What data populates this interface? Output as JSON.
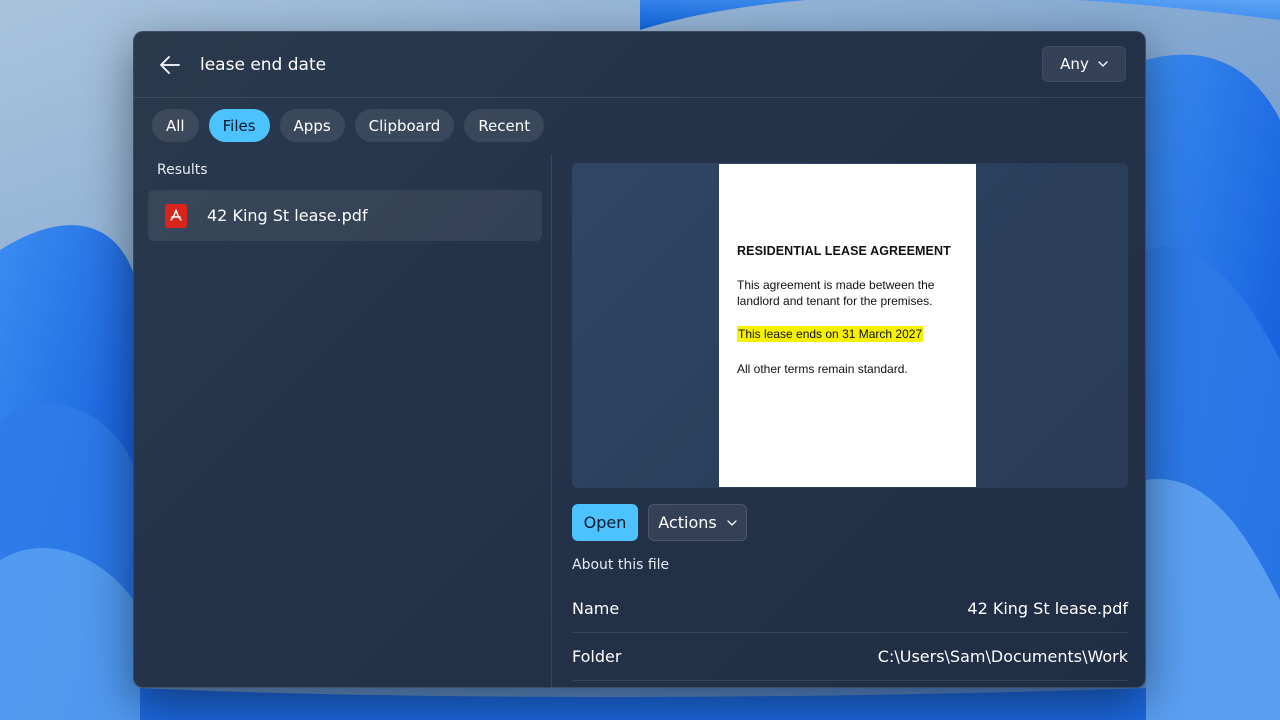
{
  "search": {
    "query": "lease end date",
    "scope_label": "Any"
  },
  "filters": [
    {
      "label": "All",
      "active": false
    },
    {
      "label": "Files",
      "active": true
    },
    {
      "label": "Apps",
      "active": false
    },
    {
      "label": "Clipboard",
      "active": false
    },
    {
      "label": "Recent",
      "active": false
    }
  ],
  "results": {
    "heading": "Results",
    "items": [
      {
        "name": "42 King St lease.pdf",
        "icon": "pdf-icon"
      }
    ]
  },
  "preview": {
    "document": {
      "title": "RESIDENTIAL LEASE AGREEMENT",
      "paragraph_1": "This agreement is made between the landlord and tenant for the premises.",
      "highlighted_line": "This lease ends on 31 March 2027",
      "paragraph_2": "All other terms remain standard."
    },
    "open_label": "Open",
    "actions_label": "Actions"
  },
  "details": {
    "heading": "About this file",
    "rows": [
      {
        "label": "Name",
        "value": "42 King St lease.pdf"
      },
      {
        "label": "Folder",
        "value": "C:\\Users\\Sam\\Documents\\Work"
      }
    ]
  },
  "colors": {
    "accent": "#4cc2ff",
    "highlight": "#f7f100",
    "pdf_red": "#d9241c"
  }
}
